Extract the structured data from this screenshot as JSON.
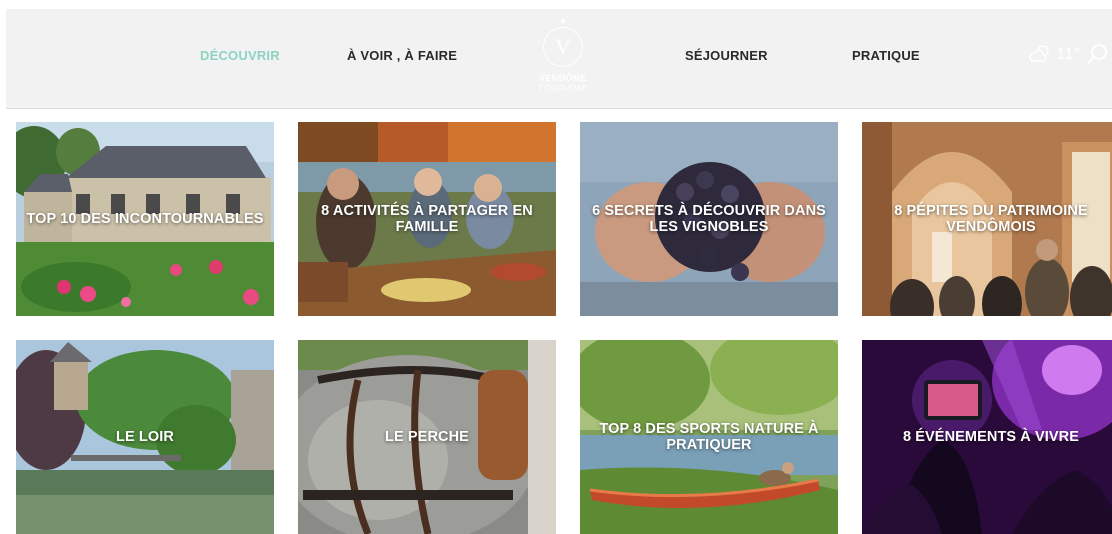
{
  "nav": {
    "left": [
      "DÉCOUVRIR",
      "À VOIR , À FAIRE"
    ],
    "right": [
      "SÉJOURNER",
      "PRATIQUE"
    ]
  },
  "logo": {
    "letter": "V",
    "name": "VENDÔME",
    "sub": "TOURISME"
  },
  "weather": {
    "icon": "partly-cloudy-icon",
    "temperature": "11°"
  },
  "search": {
    "icon": "search-icon"
  },
  "colors": {
    "accent": "#8dd3c4",
    "header_bg": "#f2f2f2"
  },
  "tiles": [
    {
      "title": "TOP 10 DES INCONTOURNABLES"
    },
    {
      "title": "8 ACTIVITÉS À PARTAGER EN FAMILLE"
    },
    {
      "title": "6 SECRETS À DÉCOUVRIR DANS LES VIGNOBLES"
    },
    {
      "title": "8 PÉPITES DU PATRIMOINE VENDÔMOIS"
    },
    {
      "title": "LE LOIR"
    },
    {
      "title": "LE PERCHE"
    },
    {
      "title": "TOP 8 DES SPORTS NATURE À PRATIQUER"
    },
    {
      "title": "8 ÉVÉNEMENTS À VIVRE"
    }
  ]
}
